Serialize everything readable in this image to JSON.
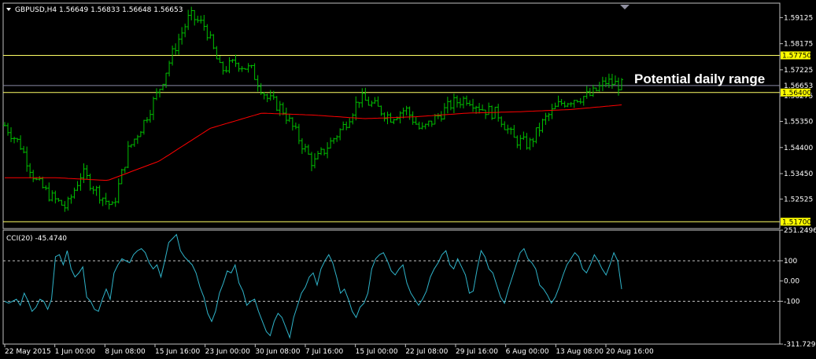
{
  "colors": {
    "background": "#000000",
    "frame": "#c0c0c0",
    "candle": "#00c000",
    "ma": "#ff0000",
    "level": "#ffff66",
    "bid": "#8a8aa6",
    "cci": "#2fb3c9",
    "text": "#ffffff",
    "level_label_bg": "#ffff00"
  },
  "header": {
    "title": "GBPUSD,H4  1.56649 1.56833 1.56648 1.56653",
    "dropdown_icon": "triangle-down-icon"
  },
  "annotation": {
    "label": "Potential daily range"
  },
  "cci": {
    "title": "CCI(20) -45.4740"
  },
  "chart_data": [
    {
      "type": "candlestick",
      "symbol": "GBPUSD",
      "timeframe": "H4",
      "ohlc_last": {
        "open": 1.56649,
        "high": 1.56833,
        "low": 1.56648,
        "close": 1.56653
      },
      "ylim": [
        1.5145,
        1.5965
      ],
      "y_ticks": [
        1.59125,
        1.58175,
        1.57225,
        1.56275,
        1.5535,
        1.544,
        1.5345,
        1.52525
      ],
      "y_tick_labels": [
        "1.59125",
        "1.58175",
        "1.57225",
        "1.56275",
        "1.55350",
        "1.54400",
        "1.53450",
        "1.52525"
      ],
      "levels": [
        {
          "value": 1.5775,
          "label": "1.57750",
          "kind": "resistance"
        },
        {
          "value": 1.564,
          "label": "1.56400",
          "kind": "support"
        },
        {
          "value": 1.517,
          "label": "1.51700",
          "kind": "range-low"
        }
      ],
      "bid": {
        "value": 1.56653,
        "label": "1.56653"
      },
      "x_labels": [
        "22 May 2015",
        "1 Jun 00:00",
        "8 Jun 08:00",
        "15 Jun 16:00",
        "23 Jun 00:00",
        "30 Jun 08:00",
        "7 Jul 16:00",
        "15 Jul 00:00",
        "22 Jul 08:00",
        "29 Jul 16:00",
        "6 Aug 00:00",
        "13 Aug 08:00",
        "20 Aug 16:00"
      ],
      "close_path": [
        [
          "22 May",
          1.552
        ],
        [
          "25 May",
          1.545
        ],
        [
          "27 May",
          1.532
        ],
        [
          "29 May",
          1.526
        ],
        [
          "1 Jun",
          1.522
        ],
        [
          "3 Jun",
          1.535
        ],
        [
          "5 Jun",
          1.528
        ],
        [
          "8 Jun",
          1.522
        ],
        [
          "10 Jun",
          1.543
        ],
        [
          "12 Jun",
          1.553
        ],
        [
          "15 Jun",
          1.565
        ],
        [
          "16 Jun",
          1.58
        ],
        [
          "17 Jun",
          1.592
        ],
        [
          "19 Jun",
          1.588
        ],
        [
          "23 Jun",
          1.572
        ],
        [
          "26 Jun",
          1.575
        ],
        [
          "29 Jun",
          1.572
        ],
        [
          "30 Jun",
          1.562
        ],
        [
          "2 Jul",
          1.558
        ],
        [
          "6 Jul",
          1.548
        ],
        [
          "8 Jul",
          1.538
        ],
        [
          "9 Jul",
          1.545
        ],
        [
          "13 Jul",
          1.552
        ],
        [
          "15 Jul",
          1.562
        ],
        [
          "17 Jul",
          1.559
        ],
        [
          "20 Jul",
          1.555
        ],
        [
          "22 Jul",
          1.558
        ],
        [
          "24 Jul",
          1.55
        ],
        [
          "27 Jul",
          1.555
        ],
        [
          "29 Jul",
          1.56
        ],
        [
          "31 Jul",
          1.562
        ],
        [
          "3 Aug",
          1.558
        ],
        [
          "5 Aug",
          1.556
        ],
        [
          "6 Aug",
          1.547
        ],
        [
          "7 Aug",
          1.545
        ],
        [
          "10 Aug",
          1.554
        ],
        [
          "12 Aug",
          1.56
        ],
        [
          "14 Aug",
          1.562
        ],
        [
          "17 Aug",
          1.563
        ],
        [
          "19 Aug",
          1.568
        ],
        [
          "21 Aug",
          1.5665
        ]
      ],
      "moving_average_path": [
        [
          "22 May",
          1.533
        ],
        [
          "1 Jun",
          1.533
        ],
        [
          "8 Jun",
          1.532
        ],
        [
          "15 Jun",
          1.539
        ],
        [
          "23 Jun",
          1.551
        ],
        [
          "30 Jun",
          1.5565
        ],
        [
          "7 Jul",
          1.5558
        ],
        [
          "15 Jul",
          1.5545
        ],
        [
          "22 Jul",
          1.5552
        ],
        [
          "29 Jul",
          1.5565
        ],
        [
          "6 Aug",
          1.557
        ],
        [
          "13 Aug",
          1.5578
        ],
        [
          "21 Aug",
          1.5595
        ]
      ]
    },
    {
      "type": "line",
      "indicator": "CCI",
      "period": 20,
      "last_value": -45.474,
      "ylim": [
        -311.7293,
        251.2496
      ],
      "y_tick_labels": [
        "251.2496",
        "100",
        "0.00",
        "-100",
        "-311.7293"
      ],
      "levels": [
        100,
        -100
      ],
      "values": [
        -100,
        -110,
        -100,
        -90,
        -120,
        -60,
        -100,
        -150,
        -130,
        -90,
        -100,
        -140,
        -90,
        120,
        130,
        80,
        150,
        60,
        20,
        40,
        70,
        -80,
        -100,
        -140,
        -150,
        -90,
        -40,
        -90,
        40,
        80,
        110,
        100,
        90,
        130,
        150,
        160,
        140,
        90,
        60,
        80,
        20,
        100,
        190,
        210,
        230,
        150,
        120,
        100,
        80,
        40,
        -30,
        -80,
        -160,
        -200,
        -150,
        -60,
        -10,
        50,
        40,
        80,
        -10,
        -50,
        -120,
        -100,
        -90,
        -150,
        -200,
        -250,
        -270,
        -200,
        -160,
        -180,
        -230,
        -280,
        -180,
        -120,
        -60,
        -30,
        20,
        40,
        -20,
        60,
        100,
        130,
        90,
        20,
        -60,
        -40,
        -90,
        -150,
        -180,
        -130,
        -110,
        -60,
        60,
        110,
        130,
        140,
        100,
        50,
        30,
        60,
        80,
        -10,
        -60,
        -90,
        -120,
        -90,
        -50,
        20,
        60,
        90,
        130,
        150,
        80,
        60,
        110,
        70,
        30,
        -60,
        -50,
        60,
        150,
        120,
        60,
        40,
        -20,
        -80,
        -110,
        -40,
        20,
        80,
        140,
        160,
        110,
        90,
        60,
        -20,
        -40,
        -70,
        -110,
        -80,
        -30,
        30,
        80,
        110,
        140,
        120,
        60,
        40,
        80,
        130,
        100,
        60,
        30,
        80,
        140,
        100,
        -40
      ]
    }
  ]
}
